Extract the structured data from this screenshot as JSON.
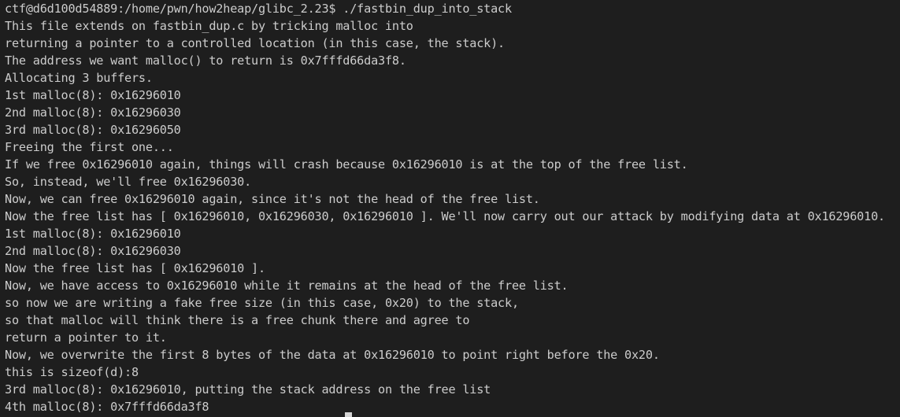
{
  "terminal": {
    "prompt": "ctf@d6d100d54889:/home/pwn/how2heap/glibc_2.23$ ./fastbin_dup_into_stack",
    "lines": [
      "This file extends on fastbin_dup.c by tricking malloc into",
      "returning a pointer to a controlled location (in this case, the stack).",
      "The address we want malloc() to return is 0x7fffd66da3f8.",
      "Allocating 3 buffers.",
      "1st malloc(8): 0x16296010",
      "2nd malloc(8): 0x16296030",
      "3rd malloc(8): 0x16296050",
      "Freeing the first one...",
      "If we free 0x16296010 again, things will crash because 0x16296010 is at the top of the free list.",
      "So, instead, we'll free 0x16296030.",
      "Now, we can free 0x16296010 again, since it's not the head of the free list.",
      "Now the free list has [ 0x16296010, 0x16296030, 0x16296010 ]. We'll now carry out our attack by modifying data at 0x16296010.",
      "1st malloc(8): 0x16296010",
      "2nd malloc(8): 0x16296030",
      "Now the free list has [ 0x16296010 ].",
      "Now, we have access to 0x16296010 while it remains at the head of the free list.",
      "so now we are writing a fake free size (in this case, 0x20) to the stack,",
      "so that malloc will think there is a free chunk there and agree to",
      "return a pointer to it.",
      "Now, we overwrite the first 8 bytes of the data at 0x16296010 to point right before the 0x20.",
      "this is sizeof(d):8",
      "3rd malloc(8): 0x16296010, putting the stack address on the free list",
      "4th malloc(8): 0x7fffd66da3f8"
    ]
  }
}
